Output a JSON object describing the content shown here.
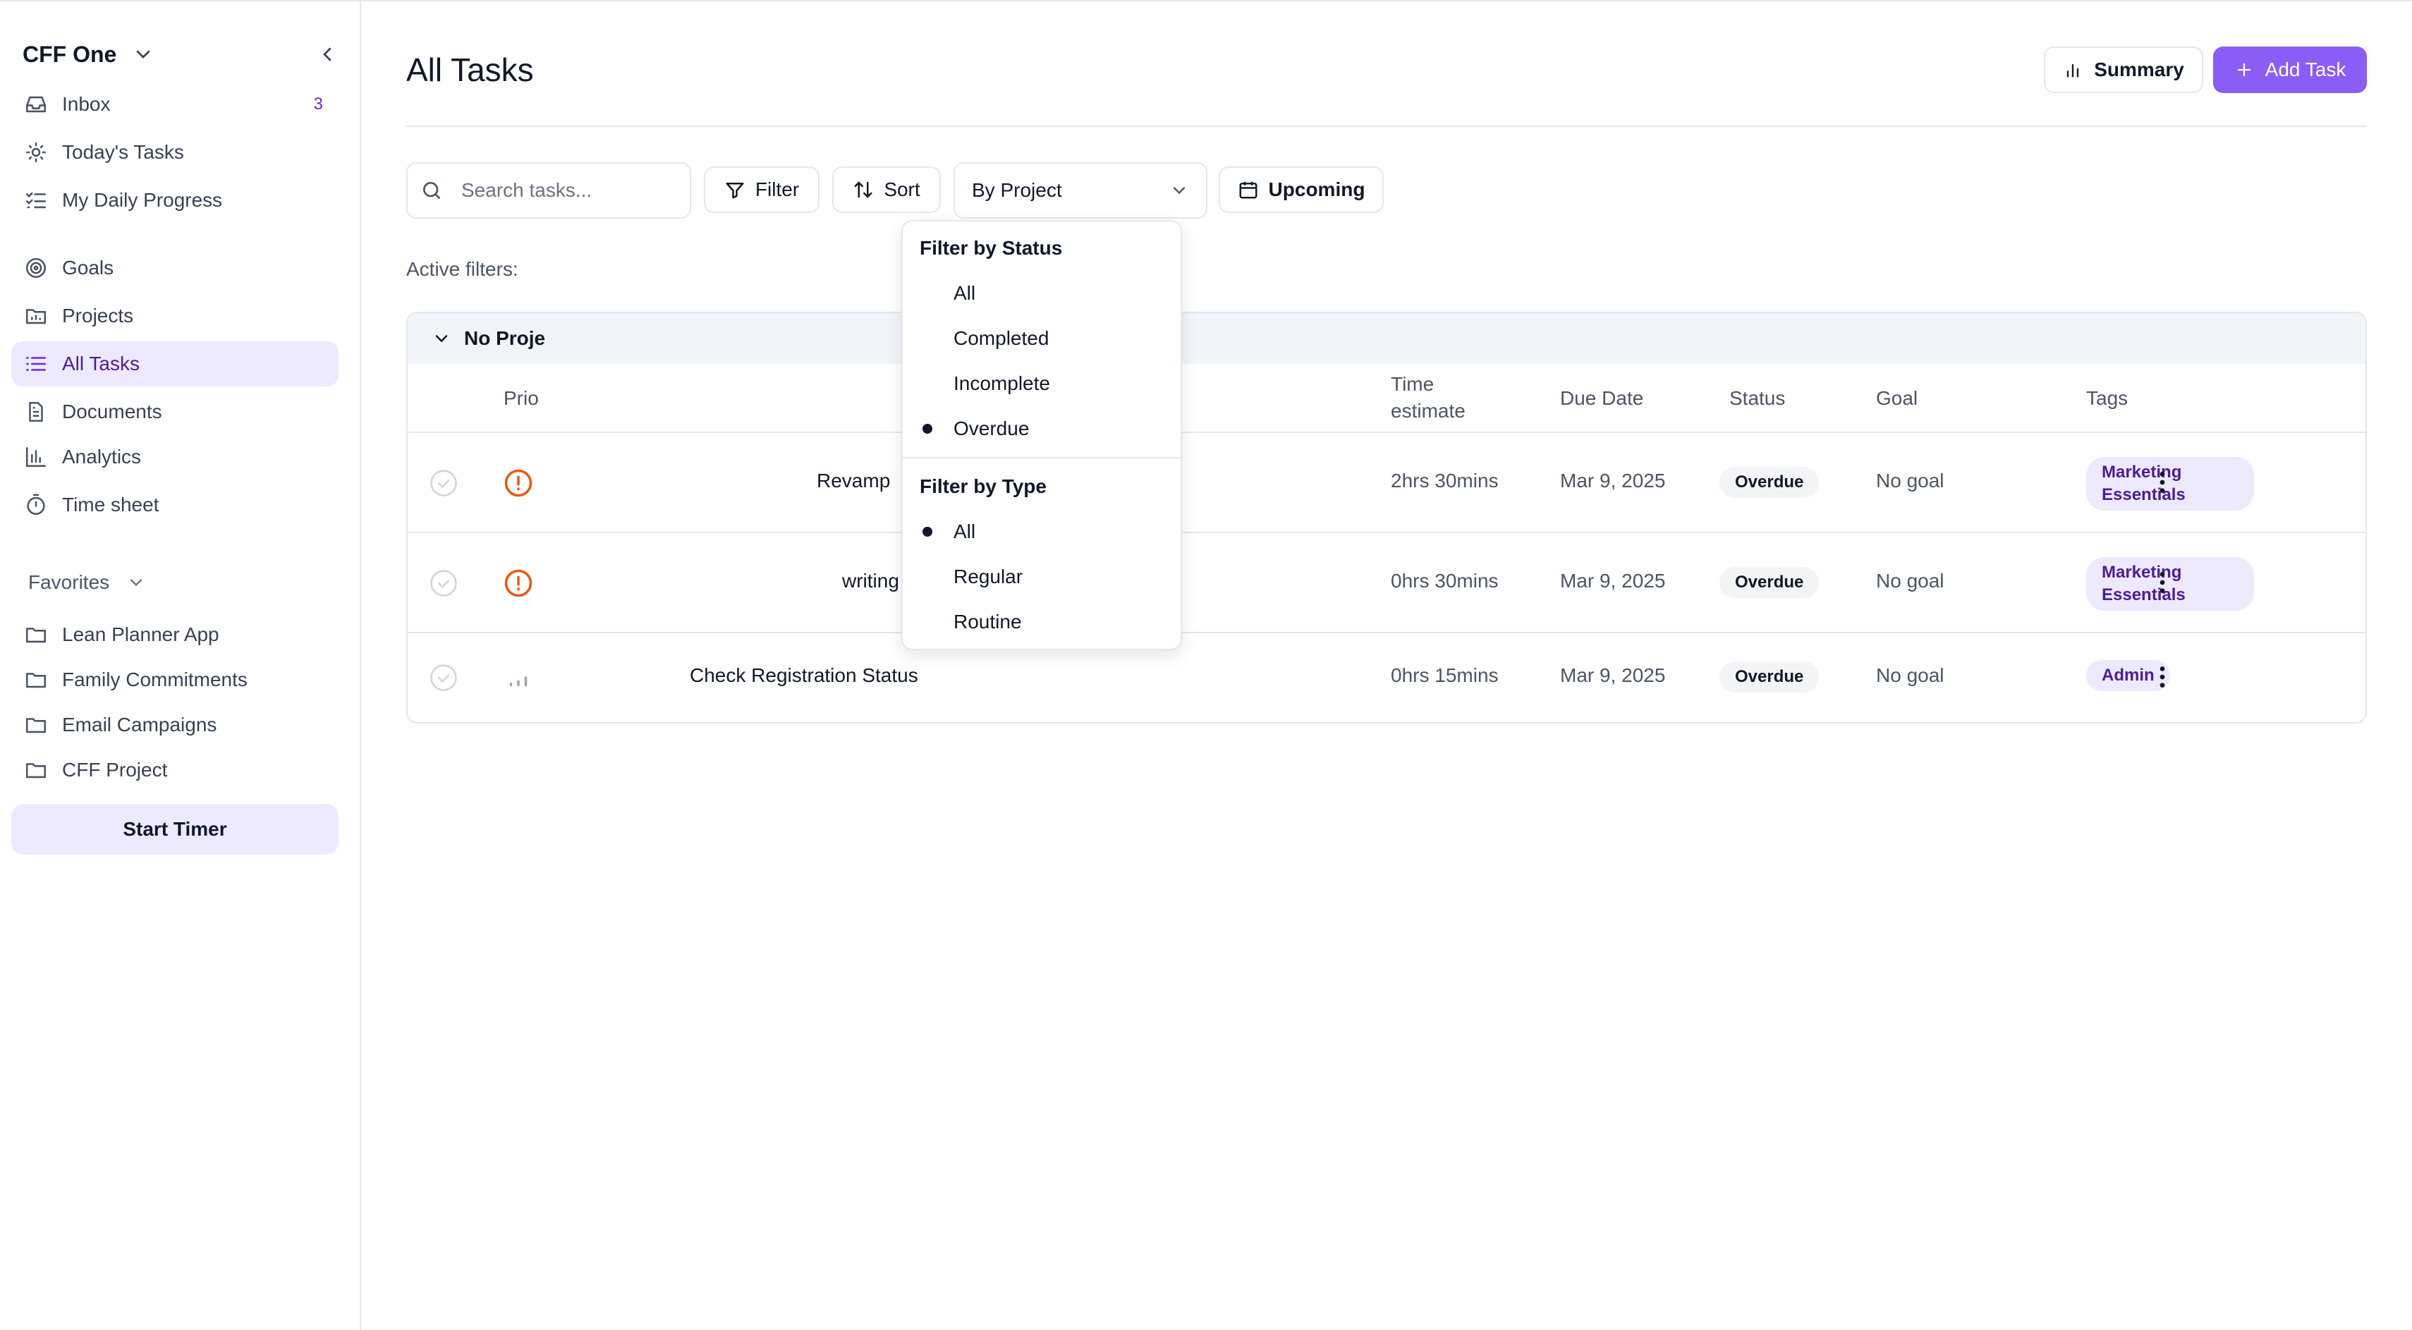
{
  "sidebar": {
    "workspace_name": "CFF One",
    "nav": [
      {
        "label": "Inbox",
        "count": "3"
      },
      {
        "label": "Today's Tasks"
      },
      {
        "label": "My Daily Progress"
      },
      {
        "label": "Goals"
      },
      {
        "label": "Projects"
      },
      {
        "label": "All Tasks"
      },
      {
        "label": "Documents"
      },
      {
        "label": "Analytics"
      },
      {
        "label": "Time sheet"
      }
    ],
    "favorites_label": "Favorites",
    "favorites": [
      {
        "label": "Lean Planner App"
      },
      {
        "label": "Family Commitments"
      },
      {
        "label": "Email Campaigns"
      },
      {
        "label": "CFF Project"
      }
    ],
    "start_timer_label": "Start Timer"
  },
  "header": {
    "title": "All Tasks",
    "summary_label": "Summary",
    "add_task_label": "Add Task"
  },
  "toolbar": {
    "search_placeholder": "Search tasks...",
    "filter_label": "Filter",
    "sort_label": "Sort",
    "group_by_value": "By Project",
    "upcoming_label": "Upcoming",
    "active_filters_label": "Active filters:"
  },
  "table": {
    "group_label": "No Proje",
    "columns": {
      "priority": "Prio",
      "time_estimate_line1": "Time",
      "time_estimate_line2": "estimate",
      "due_date": "Due Date",
      "status": "Status",
      "goal": "Goal",
      "tags": "Tags"
    },
    "rows": [
      {
        "name": "Revamp",
        "time": "2hrs 30mins",
        "due": "Mar 9, 2025",
        "status": "Overdue",
        "goal": "No goal",
        "tag_line1": "Marketing",
        "tag_line2": "Essentials",
        "priority": "urgent"
      },
      {
        "name": "writing",
        "time": "0hrs 30mins",
        "due": "Mar 9, 2025",
        "status": "Overdue",
        "goal": "No goal",
        "tag_line1": "Marketing",
        "tag_line2": "Essentials",
        "priority": "urgent"
      },
      {
        "name": "Check Registration Status",
        "time": "0hrs 15mins",
        "due": "Mar 9, 2025",
        "status": "Overdue",
        "goal": "No goal",
        "tag_line1": "Admin",
        "tag_line2": "",
        "priority": "low"
      }
    ]
  },
  "filter_menu": {
    "status_heading": "Filter by Status",
    "status_options": [
      "All",
      "Completed",
      "Incomplete",
      "Overdue"
    ],
    "status_selected": "Overdue",
    "type_heading": "Filter by Type",
    "type_options": [
      "All",
      "Regular",
      "Routine"
    ],
    "type_selected": "All"
  },
  "colors": {
    "accent": "#8b5cf6",
    "accent_light": "#ede9fe",
    "accent_dark": "#4c1d95",
    "urgent": "#ea580c"
  }
}
